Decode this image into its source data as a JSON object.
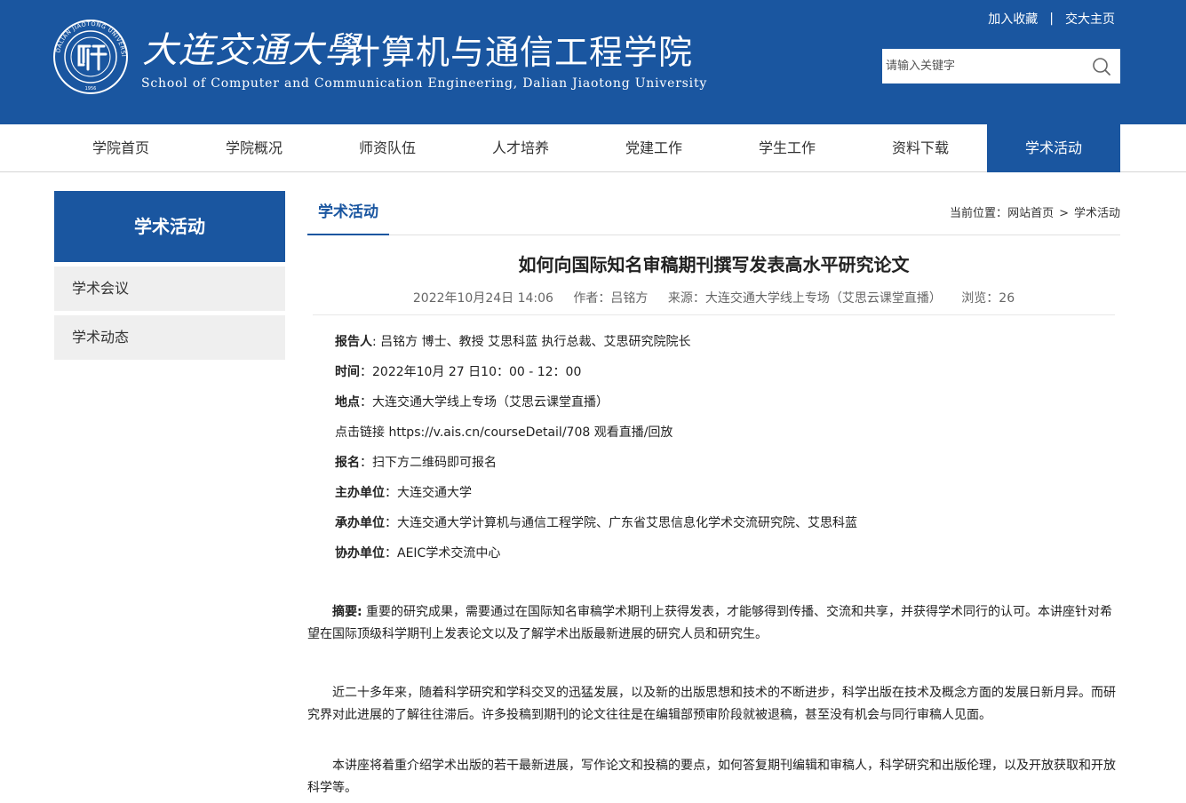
{
  "header": {
    "brand_calligraphy": "大连交通大學",
    "brand_cn": "计算机与通信工程学院",
    "brand_en": "School of Computer and Communication Engineering, Dalian Jiaotong University",
    "emblem_text": "DALIAN JIAOTONG UNIVERSITY",
    "emblem_year": "1956",
    "top_links": [
      "加入收藏",
      "交大主页"
    ],
    "search_placeholder": "请输入关键字"
  },
  "nav": {
    "items": [
      "学院首页",
      "学院概况",
      "师资队伍",
      "人才培养",
      "党建工作",
      "学生工作",
      "资料下载",
      "学术活动"
    ],
    "active": "学术活动"
  },
  "sidebar": {
    "title": "学术活动",
    "items": [
      "学术会议",
      "学术动态"
    ]
  },
  "main": {
    "section_tab": "学术活动",
    "breadcrumb": {
      "prefix": "当前位置：",
      "items": [
        "网站首页",
        "学术活动"
      ],
      "separator": ">"
    },
    "article": {
      "title": "如何向国际知名审稿期刊撰写发表高水平研究论文",
      "date": "2022年10月24日 14:06",
      "author": "作者：吕铭方",
      "source": "来源：大连交通大学线上专场（艾思云课堂直播）",
      "views": "浏览：26",
      "info": [
        {
          "label": "报告人",
          "sep": ":",
          "value": " 吕铭方 博士、教授 艾思科蓝 执行总裁、艾思研究院院长"
        },
        {
          "label": "时间",
          "sep": "：",
          "value": "2022年10月 27 日10：00 - 12：00"
        },
        {
          "label": "地点",
          "sep": "：",
          "value": "大连交通大学线上专场（艾思云课堂直播）"
        },
        {
          "label": "",
          "sep": "",
          "value": "点击链接 https://v.ais.cn/courseDetail/708 观看直播/回放"
        },
        {
          "label": "报名",
          "sep": "：",
          "value": "扫下方二维码即可报名"
        },
        {
          "label": "主办单位",
          "sep": "：",
          "value": "大连交通大学"
        },
        {
          "label": "承办单位",
          "sep": "：",
          "value": "大连交通大学计算机与通信工程学院、广东省艾思信息化学术交流研究院、艾思科蓝"
        },
        {
          "label": "协办单位",
          "sep": "：",
          "value": "AEIC学术交流中心"
        }
      ],
      "abstract_label": "摘要",
      "abstract_sep": ":",
      "abstract_text": " 重要的研究成果，需要通过在国际知名审稿学术期刊上获得发表，才能够得到传播、交流和共享，并获得学术同行的认可。本讲座针对希望在国际顶级科学期刊上发表论文以及了解学术出版最新进展的研究人员和研究生。",
      "paragraphs": [
        "近二十多年来，随着科学研究和学科交叉的迅猛发展，以及新的出版思想和技术的不断进步，科学出版在技术及概念方面的发展日新月异。而研究界对此进展的了解往往滞后。许多投稿到期刊的论文往往是在编辑部预审阶段就被退稿，甚至没有机会与同行审稿人见面。",
        "本讲座将着重介绍学术出版的若干最新进展，写作论文和投稿的要点，如何答复期刊编辑和审稿人，科学研究和出版伦理，以及开放获取和开放科学等。"
      ]
    }
  },
  "colors": {
    "primary": "#1a56a0",
    "sidebar_item_bg": "#efefef"
  },
  "icons": [
    "university-emblem-icon",
    "search-icon"
  ]
}
